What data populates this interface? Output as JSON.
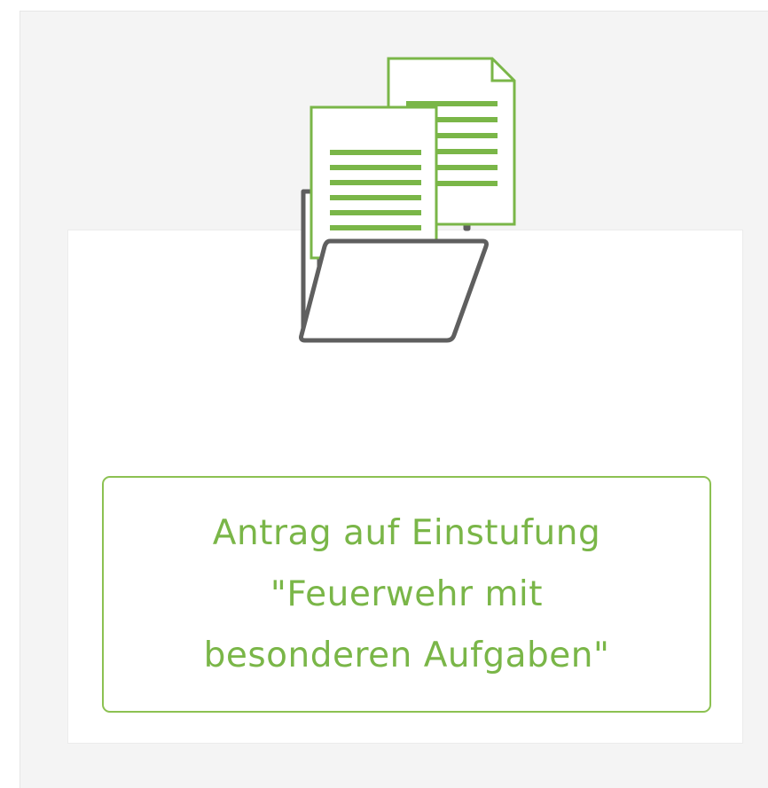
{
  "card": {
    "icon": "folder-with-documents-icon",
    "button_label": "Antrag auf Einstufung\n\"Feuerwehr mit\nbesonderen Aufgaben\""
  },
  "colors": {
    "accent_green": "#7ab648",
    "border_green": "#8cc152",
    "icon_gray": "#5f5f5f",
    "panel_background": "#f4f4f4"
  }
}
